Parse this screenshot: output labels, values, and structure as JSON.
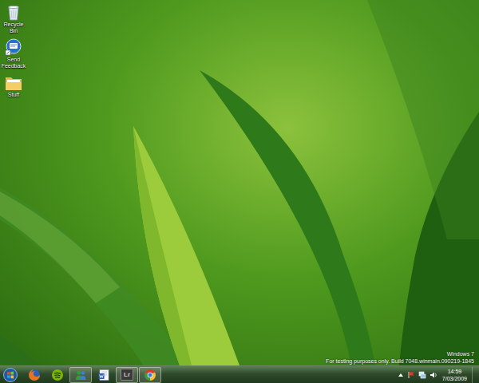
{
  "desktop_icons": [
    {
      "label": "Recycle Bin",
      "kind": "recycle"
    },
    {
      "label": "Send Feedback",
      "kind": "feedback"
    },
    {
      "label": "Stuff",
      "kind": "folder"
    }
  ],
  "watermark": {
    "lines": [
      "Windows 7",
      "For testing purposes only. Build 7048.winmain.090219-1845"
    ]
  },
  "taskbar": {
    "apps": [
      {
        "kind": "firefox",
        "label": "",
        "running": false
      },
      {
        "kind": "spotify",
        "label": "",
        "running": false
      },
      {
        "kind": "messenger",
        "label": "",
        "running": true
      },
      {
        "kind": "word",
        "label": "",
        "running": false
      },
      {
        "kind": "lightroom",
        "label": "Lr",
        "running": true
      },
      {
        "kind": "chrome",
        "label": "",
        "running": true
      }
    ]
  },
  "tray": {
    "time": "14:59",
    "date": "7/03/2009"
  }
}
